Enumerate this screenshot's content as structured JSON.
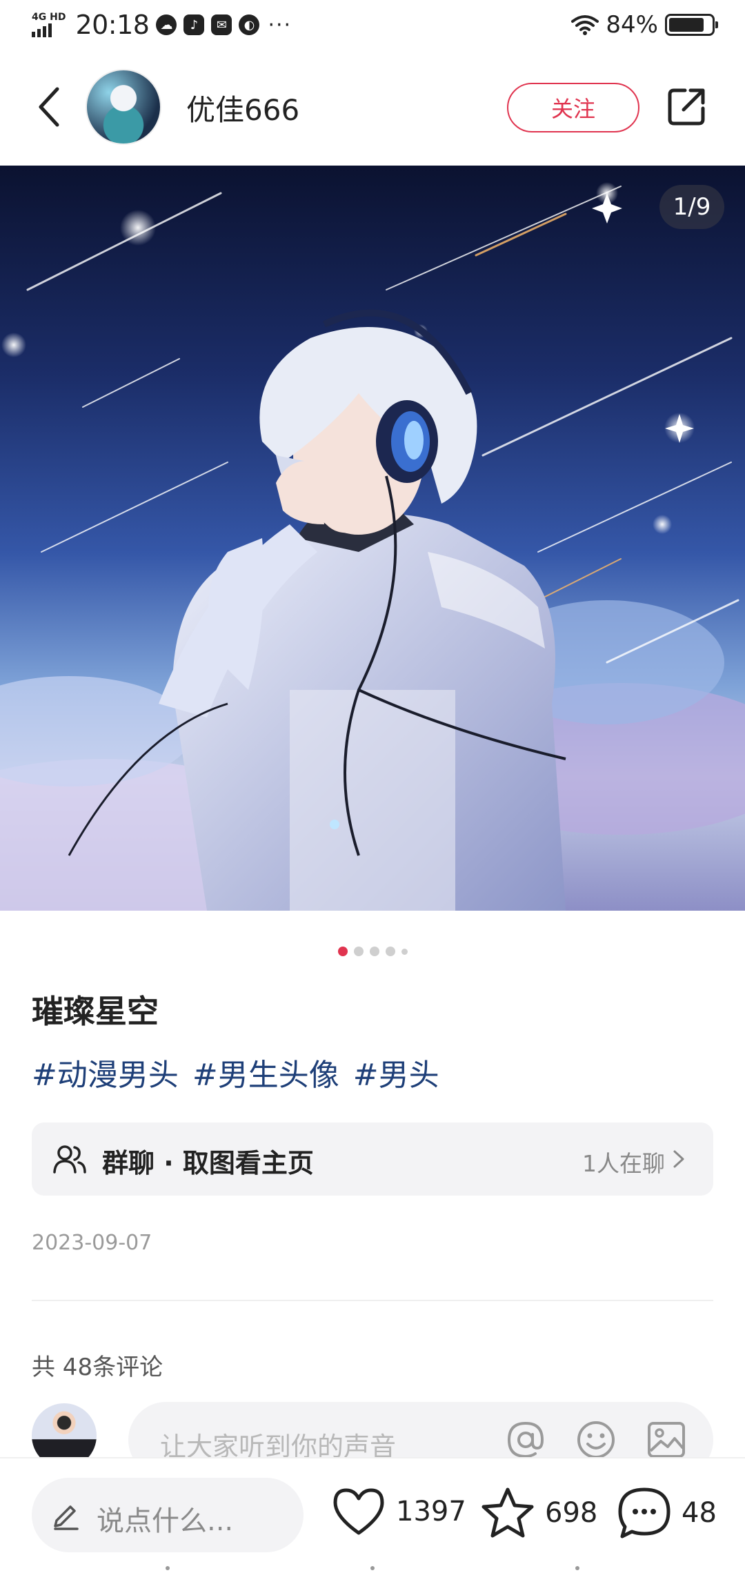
{
  "status_bar": {
    "network": "4G HD",
    "time": "20:18",
    "battery_percent": "84%",
    "battery_level": 0.84,
    "app_icons": [
      "cloud-icon",
      "tiktok-icon",
      "mail-icon",
      "planet-icon"
    ],
    "more": "···"
  },
  "header": {
    "username": "优佳666",
    "follow_label": "关注"
  },
  "image": {
    "page_indicator": "1/9",
    "total_dots": 5,
    "active_dot": 0
  },
  "post": {
    "title": "璀璨星空",
    "tags": [
      "#动漫男头",
      "#男生头像",
      "#男头"
    ],
    "group": {
      "title": "群聊 · 取图看主页",
      "status": "1人在聊"
    },
    "date": "2023-09-07"
  },
  "comments": {
    "count_label": "共 48条评论",
    "input_placeholder": "让大家听到你的声音"
  },
  "bottom_bar": {
    "say_placeholder": "说点什么...",
    "likes": "1397",
    "favorites": "698",
    "comments": "48"
  },
  "colors": {
    "accent": "#e0344f",
    "tag": "#1e3f78",
    "card_bg": "#f3f3f5"
  }
}
